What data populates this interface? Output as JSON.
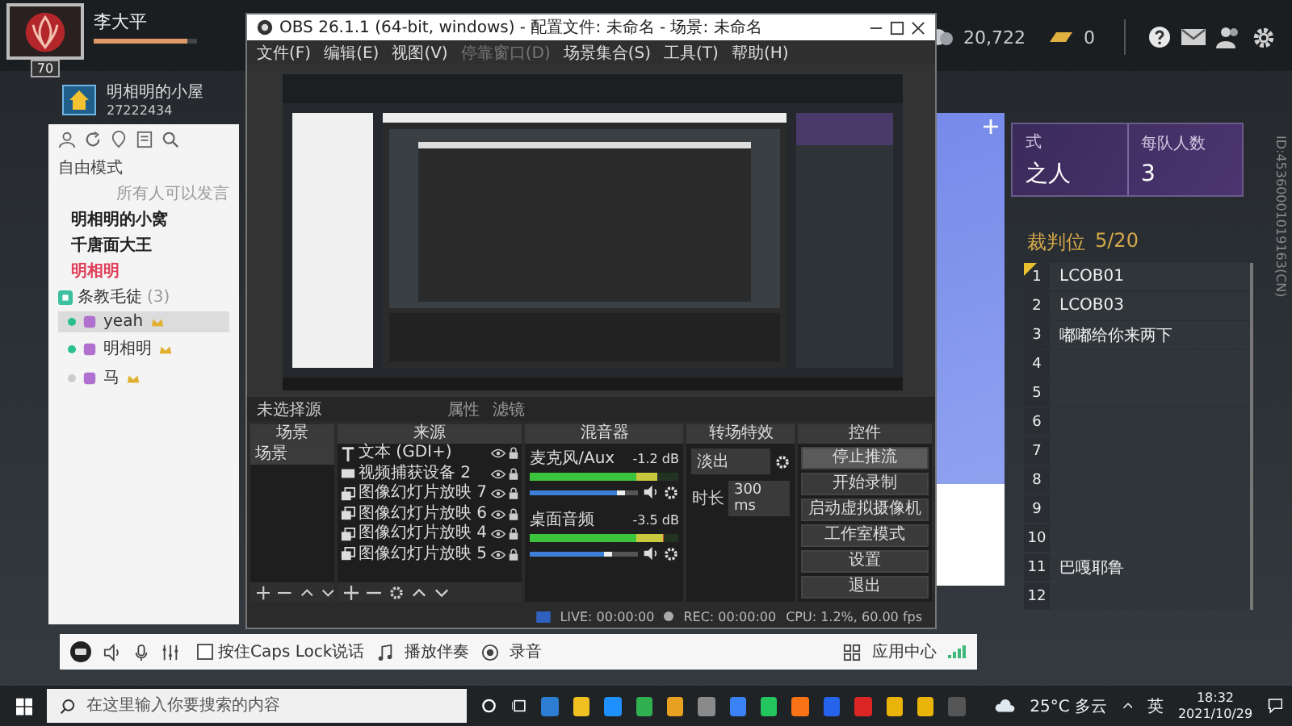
{
  "player": {
    "name": "李大平",
    "level": "70",
    "xp_bar": {
      "level": 0.9
    }
  },
  "currency": {
    "coins": "20,722",
    "gold": "0"
  },
  "room": {
    "name": "明相明的小屋",
    "id": "27222434"
  },
  "channel_panel": {
    "mode": "自由模式",
    "speak_rule": "所有人可以发言",
    "channels": [
      {
        "name": "明相明的小窝",
        "color": "#222222"
      },
      {
        "name": "千唐面大王",
        "color": "#222222"
      },
      {
        "name": "明相明",
        "color": "#e0405a"
      }
    ],
    "group": {
      "name": "条教毛徒",
      "count": "(3)",
      "members": [
        {
          "name": "yeah",
          "selected": true,
          "online": true
        },
        {
          "name": "明相明",
          "selected": false,
          "online": true
        },
        {
          "name": "马",
          "selected": false,
          "online": false
        }
      ]
    }
  },
  "game_mode": {
    "mode_label": "式",
    "mode_value": "之人",
    "team_size_label": "每队人数",
    "team_size": "3"
  },
  "referees": {
    "title": "裁判位",
    "count": "5/20",
    "slots": [
      {
        "number": "1",
        "name": "LCOB01",
        "flagged": true
      },
      {
        "number": "2",
        "name": "LCOB03",
        "flagged": false
      },
      {
        "number": "3",
        "name": "嘟嘟给你来两下",
        "flagged": false
      },
      {
        "number": "4",
        "flagged": false
      },
      {
        "number": "5",
        "flagged": false
      },
      {
        "number": "6",
        "flagged": false
      },
      {
        "number": "7",
        "flagged": false
      },
      {
        "number": "8",
        "flagged": false
      },
      {
        "number": "9",
        "flagged": false
      },
      {
        "number": "10",
        "flagged": false
      },
      {
        "number": "11",
        "name": "巴嘎耶鲁",
        "flagged": false
      },
      {
        "number": "12",
        "flagged": false
      }
    ]
  },
  "server_id": "ID:45360001019163(CN)",
  "obs": {
    "title": "OBS 26.1.1 (64-bit, windows) - 配置文件: 未命名 - 场景: 未命名",
    "menu": [
      {
        "label": "文件(F)",
        "disabled": false
      },
      {
        "label": "编辑(E)",
        "disabled": false
      },
      {
        "label": "视图(V)",
        "disabled": false
      },
      {
        "label": "停靠窗口(D)",
        "disabled": true
      },
      {
        "label": "场景集合(S)",
        "disabled": false
      },
      {
        "label": "工具(T)",
        "disabled": false
      },
      {
        "label": "帮助(H)",
        "disabled": false
      }
    ],
    "source_bar": {
      "label": "未选择源",
      "properties": "属性",
      "filters": "滤镜"
    },
    "scenes": {
      "title": "场景",
      "items": [
        {
          "name": "场景",
          "selected": true
        }
      ]
    },
    "sources": {
      "title": "来源",
      "items": [
        {
          "name": "文本 (GDI+)",
          "kind": "text"
        },
        {
          "name": "视频捕获设备 2",
          "kind": "camera"
        },
        {
          "name": "图像幻灯片放映 7",
          "kind": "slideshow"
        },
        {
          "name": "图像幻灯片放映 6",
          "kind": "slideshow"
        },
        {
          "name": "图像幻灯片放映 4",
          "kind": "slideshow"
        },
        {
          "name": "图像幻灯片放映 5",
          "kind": "slideshow"
        }
      ]
    },
    "mixer": {
      "title": "混音器",
      "channels": [
        {
          "name": "麦克风/Aux",
          "reading": "-1.2 dB",
          "meter": {
            "level": 0.85
          },
          "volume": {
            "level": 0.88
          }
        },
        {
          "name": "桌面音频",
          "reading": "-3.5 dB",
          "meter": {
            "level": 0.9
          },
          "volume": {
            "level": 0.76
          }
        }
      ]
    },
    "transitions": {
      "title": "转场特效",
      "selected": "淡出",
      "duration_label": "时长",
      "duration": "300 ms"
    },
    "controls": {
      "title": "控件",
      "buttons": [
        {
          "label": "停止推流",
          "selected": true
        },
        {
          "label": "开始录制",
          "selected": false
        },
        {
          "label": "启动虚拟摄像机",
          "selected": false
        },
        {
          "label": "工作室模式",
          "selected": false
        },
        {
          "label": "设置",
          "selected": false
        },
        {
          "label": "退出",
          "selected": false
        }
      ]
    },
    "status": {
      "live": "LIVE: 00:00:00",
      "rec": "REC: 00:00:00",
      "perf": "CPU: 1.2%, 60.00 fps"
    }
  },
  "voice_bar": {
    "push_to_talk": {
      "label": "按住Caps Lock说话",
      "checked": false
    },
    "accompaniment": "播放伴奏",
    "record": "录音",
    "app_center": "应用中心"
  },
  "taskbar": {
    "search_placeholder": "在这里输入你要搜索的内容",
    "weather": "25°C 多云",
    "ime": "英",
    "time": "18:32",
    "date": "2021/10/29"
  }
}
